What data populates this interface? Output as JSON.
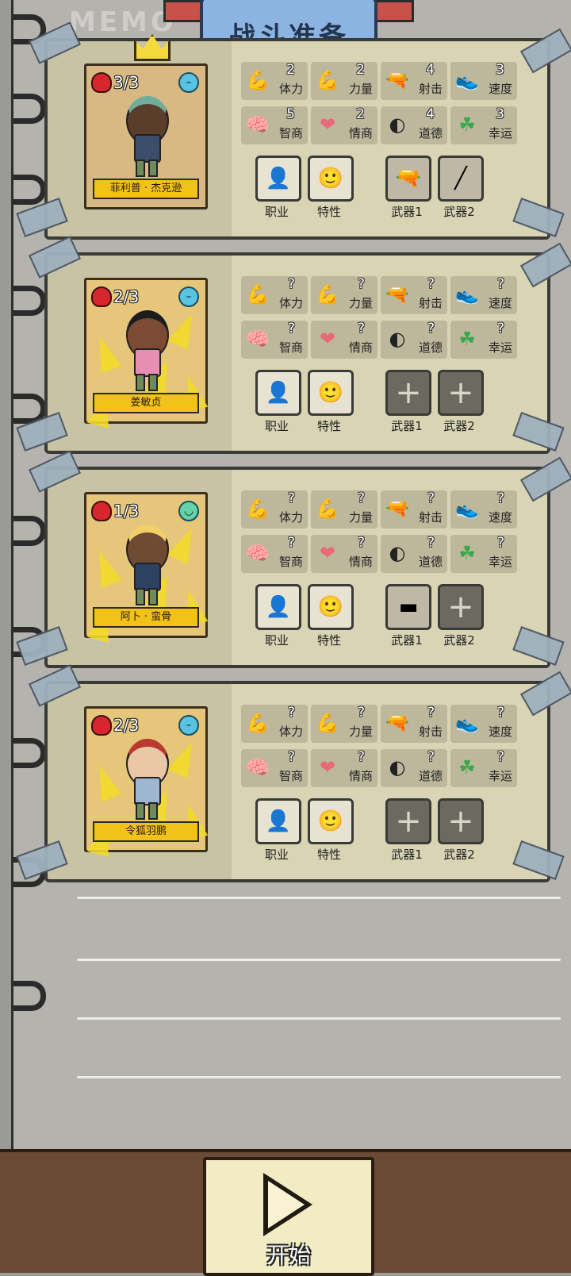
{
  "watermark": "MEMO",
  "title": "战斗准备",
  "stat_labels": [
    "体力",
    "力量",
    "射击",
    "速度",
    "智商",
    "情商",
    "道德",
    "幸运"
  ],
  "slot_labels": [
    "职业",
    "特性",
    "武器1",
    "武器2"
  ],
  "characters": [
    {
      "name": "菲利普 · 杰克逊",
      "hp": "3/3",
      "mood": "neutral",
      "stats": [
        "2",
        "2",
        "4",
        "3",
        "5",
        "2",
        "4",
        "3"
      ],
      "slots": [
        "job-portrait",
        "trait-portrait",
        "pistol",
        "crowbar"
      ]
    },
    {
      "name": "姜敏贞",
      "hp": "2/3",
      "mood": "neutral",
      "stats": [
        "?",
        "?",
        "?",
        "?",
        "?",
        "?",
        "?",
        "?"
      ],
      "slots": [
        "job-portrait",
        "trait-portrait",
        "empty",
        "empty"
      ]
    },
    {
      "name": "阿卜 · 蛮骨",
      "hp": "1/3",
      "mood": "happy",
      "stats": [
        "?",
        "?",
        "?",
        "?",
        "?",
        "?",
        "?",
        "?"
      ],
      "slots": [
        "job-portrait",
        "trait-portrait",
        "rifle",
        "empty"
      ]
    },
    {
      "name": "令狐羽鹏",
      "hp": "2/3",
      "mood": "neutral",
      "stats": [
        "?",
        "?",
        "?",
        "?",
        "?",
        "?",
        "?",
        "?"
      ],
      "slots": [
        "job-portrait",
        "trait-portrait",
        "empty",
        "empty"
      ]
    }
  ],
  "start_label": "开始",
  "colors": {
    "portrait_yellow": "#e5c67a",
    "name_plate": "#f2c21b",
    "card_bg": "#c8c3a4"
  }
}
